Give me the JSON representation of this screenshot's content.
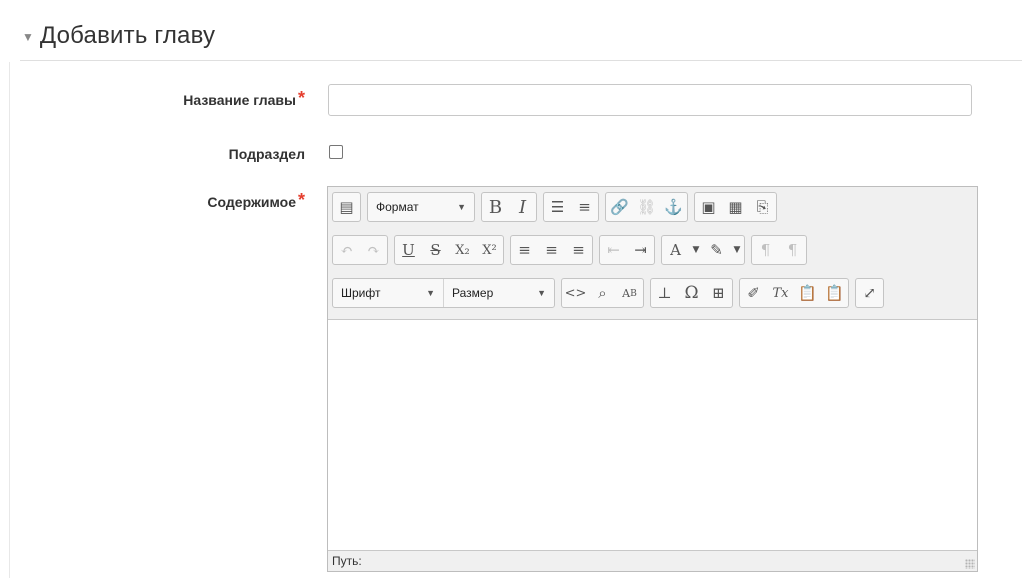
{
  "header": {
    "title": "Добавить главу"
  },
  "form": {
    "chapter_title_label": "Название главы",
    "required_mark": "*",
    "subchapter_label": "Подраздел",
    "content_label": "Содержимое",
    "chapter_title_value": "",
    "subchapter_checked": false
  },
  "editor": {
    "format_label": "Формат",
    "font_label": "Шрифт",
    "size_label": "Размер",
    "path_label": "Путь:",
    "buttons": {
      "bold": "B",
      "italic": "I",
      "underline": "U",
      "strike": "S",
      "subscript": "X₂",
      "superscript": "X²",
      "code": "<>",
      "special_char": "Ω",
      "clear_format": "Tx"
    }
  },
  "colors": {
    "required": "#e53e2e",
    "toolbar_bg": "#f0f0f0",
    "border": "#c4c4c4"
  }
}
